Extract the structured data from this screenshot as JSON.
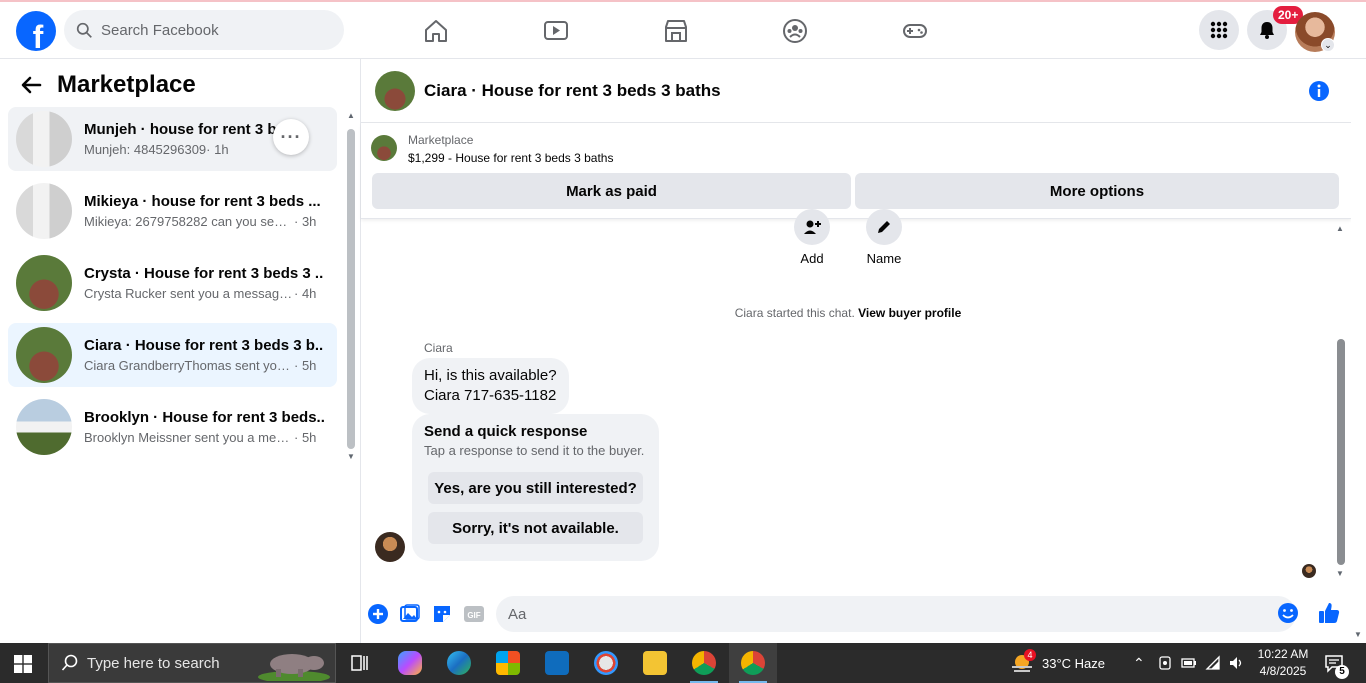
{
  "topnav": {
    "search_placeholder": "Search Facebook",
    "notifications_badge": "20+",
    "icons": [
      "home-icon",
      "video-icon",
      "marketplace-icon",
      "groups-icon",
      "gaming-icon",
      "menu-grid-icon",
      "bell-icon"
    ]
  },
  "sidebar": {
    "title": "Marketplace",
    "conversations": [
      {
        "title": "Munjeh · house for rent 3 be",
        "preview": "Munjeh: 4845296309",
        "time": "· 1h"
      },
      {
        "title": "Mikieya · house for rent 3 beds ...",
        "preview": "Mikieya: 2679758282 can you send ...",
        "time": "· 3h"
      },
      {
        "title": "Crysta · House for rent 3 beds 3 ...",
        "preview": "Crysta Rucker sent you a message ...",
        "time": "· 4h"
      },
      {
        "title": "Ciara · House for rent 3 beds 3 b...",
        "preview": "Ciara GrandberryThomas sent you ...",
        "time": "· 5h"
      },
      {
        "title": "Brooklyn · House for rent 3 beds...",
        "preview": "Brooklyn Meissner sent you a mess...",
        "time": "· 5h"
      }
    ]
  },
  "chat": {
    "title": "Ciara · House for rent 3 beds 3 baths",
    "listing": {
      "category": "Marketplace",
      "price_title": "$1,299 - House for rent 3 beds 3 baths",
      "mark_paid": "Mark as paid",
      "more_options": "More options"
    },
    "actions": {
      "add": "Add",
      "name": "Name"
    },
    "started_text": "Ciara started this chat.",
    "view_profile": "View buyer profile",
    "sender": "Ciara",
    "message_line1": "Hi, is this available?",
    "message_line2": "Ciara 717-635-1182",
    "quick": {
      "title": "Send a quick response",
      "subtitle": "Tap a response to send it to the buyer.",
      "option1": "Yes, are you still interested?",
      "option2": "Sorry, it's not available."
    },
    "composer_placeholder": "Aa",
    "colors": {
      "accent": "#0866ff",
      "bubble": "#f0f2f5",
      "button": "#e4e6eb"
    }
  },
  "taskbar": {
    "search_placeholder": "Type here to search",
    "weather": "33°C  Haze",
    "weather_badge": "4",
    "time": "10:22 AM",
    "date": "4/8/2025",
    "notifications": "5"
  }
}
